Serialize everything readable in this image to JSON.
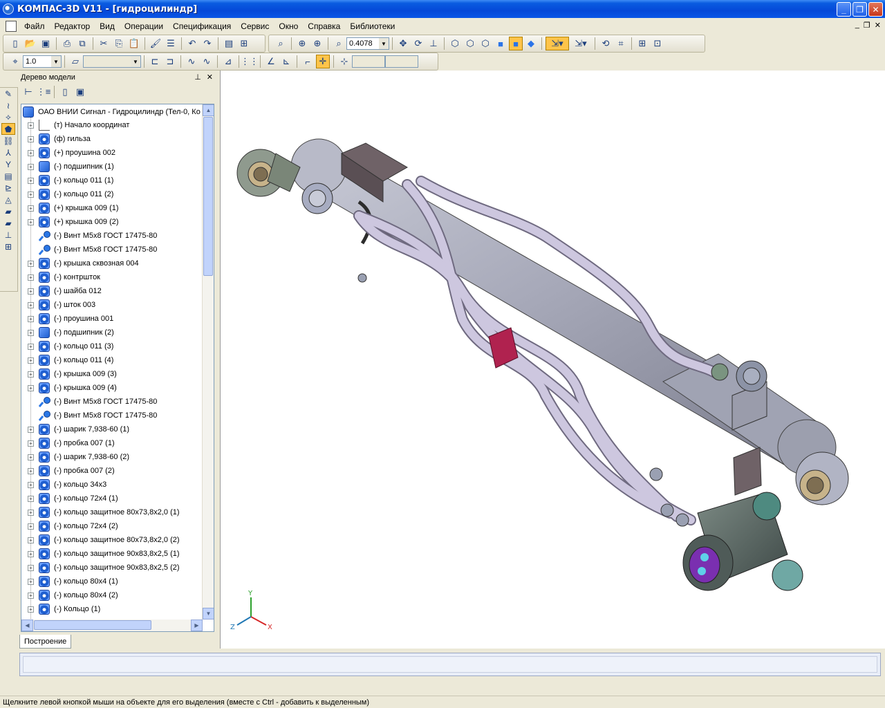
{
  "window": {
    "title": "КОМПАС-3D V11 - [гидроцилиндр]"
  },
  "menu": [
    "Файл",
    "Редактор",
    "Вид",
    "Операции",
    "Спецификация",
    "Сервис",
    "Окно",
    "Справка",
    "Библиотеки"
  ],
  "toolbar": {
    "zoom_value": "0.4078",
    "step_value": "1.0"
  },
  "tree_panel": {
    "title": "Дерево модели",
    "root": "ОАО ВНИИ Сигнал - Гидроцилиндр (Тел-0, Ко",
    "tab_label": "Построение",
    "items": [
      {
        "label": "(т) Начало координат",
        "icon": "origin-icon",
        "expand": true
      },
      {
        "label": "(ф) гильза",
        "icon": "part-icon",
        "expand": true
      },
      {
        "label": "(+) проушина 002",
        "icon": "part-icon",
        "expand": true
      },
      {
        "label": "(-) подшипник (1)",
        "icon": "bearing-icon",
        "expand": true
      },
      {
        "label": "(-) кольцо 011 (1)",
        "icon": "part-icon",
        "expand": true
      },
      {
        "label": "(-) кольцо 011 (2)",
        "icon": "part-icon",
        "expand": true
      },
      {
        "label": "(+) крышка 009 (1)",
        "icon": "part-icon",
        "expand": true
      },
      {
        "label": "(+) крышка 009 (2)",
        "icon": "part-icon",
        "expand": true
      },
      {
        "label": "(-) Винт М5х8 ГОСТ 17475-80",
        "icon": "screw-icon",
        "expand": false
      },
      {
        "label": "(-) Винт М5х8 ГОСТ 17475-80",
        "icon": "screw-icon",
        "expand": false
      },
      {
        "label": "(-) крышка сквозная 004",
        "icon": "part-icon",
        "expand": true
      },
      {
        "label": "(-) контршток",
        "icon": "part-icon",
        "expand": true
      },
      {
        "label": "(-) шайба 012",
        "icon": "part-icon",
        "expand": true
      },
      {
        "label": "(-) шток 003",
        "icon": "part-icon",
        "expand": true
      },
      {
        "label": "(-) проушина 001",
        "icon": "part-icon",
        "expand": true
      },
      {
        "label": "(-) подшипник (2)",
        "icon": "bearing-icon",
        "expand": true
      },
      {
        "label": "(-) кольцо 011 (3)",
        "icon": "part-icon",
        "expand": true
      },
      {
        "label": "(-) кольцо 011 (4)",
        "icon": "part-icon",
        "expand": true
      },
      {
        "label": "(-) крышка 009 (3)",
        "icon": "part-icon",
        "expand": true
      },
      {
        "label": "(-) крышка 009 (4)",
        "icon": "part-icon",
        "expand": true
      },
      {
        "label": "(-) Винт М5х8 ГОСТ 17475-80",
        "icon": "screw-icon",
        "expand": false
      },
      {
        "label": "(-) Винт М5х8 ГОСТ 17475-80",
        "icon": "screw-icon",
        "expand": false
      },
      {
        "label": "(-) шарик 7,938-60 (1)",
        "icon": "part-icon",
        "expand": true
      },
      {
        "label": "(-) пробка 007 (1)",
        "icon": "part-icon",
        "expand": true
      },
      {
        "label": "(-) шарик 7,938-60 (2)",
        "icon": "part-icon",
        "expand": true
      },
      {
        "label": "(-) пробка 007 (2)",
        "icon": "part-icon",
        "expand": true
      },
      {
        "label": "(-) кольцо 34х3",
        "icon": "part-icon",
        "expand": true
      },
      {
        "label": "(-) кольцо 72х4 (1)",
        "icon": "part-icon",
        "expand": true
      },
      {
        "label": "(-) кольцо защитное 80х73,8х2,0 (1)",
        "icon": "part-icon",
        "expand": true
      },
      {
        "label": "(-) кольцо 72х4 (2)",
        "icon": "part-icon",
        "expand": true
      },
      {
        "label": "(-) кольцо защитное 80х73,8х2,0 (2)",
        "icon": "part-icon",
        "expand": true
      },
      {
        "label": "(-) кольцо защитное 90х83,8х2,5 (1)",
        "icon": "part-icon",
        "expand": true
      },
      {
        "label": "(-) кольцо защитное 90х83,8х2,5 (2)",
        "icon": "part-icon",
        "expand": true
      },
      {
        "label": "(-) кольцо 80х4 (1)",
        "icon": "part-icon",
        "expand": true
      },
      {
        "label": "(-) кольцо 80х4 (2)",
        "icon": "part-icon",
        "expand": true
      },
      {
        "label": "(-) Кольцо (1)",
        "icon": "part-icon",
        "expand": true
      }
    ]
  },
  "viewport": {
    "axis_x": "X",
    "axis_y": "Y",
    "axis_z": "Z"
  },
  "status": {
    "hint": "Щелкните левой кнопкой мыши на объекте для его выделения (вместе с Ctrl - добавить к выделенным)"
  },
  "colors": {
    "title_blue": "#0548d8",
    "highlight": "#ffc44a",
    "clamp": "#b0224f",
    "pipe": "#c9c2dc",
    "body": "#a3a6b7"
  }
}
